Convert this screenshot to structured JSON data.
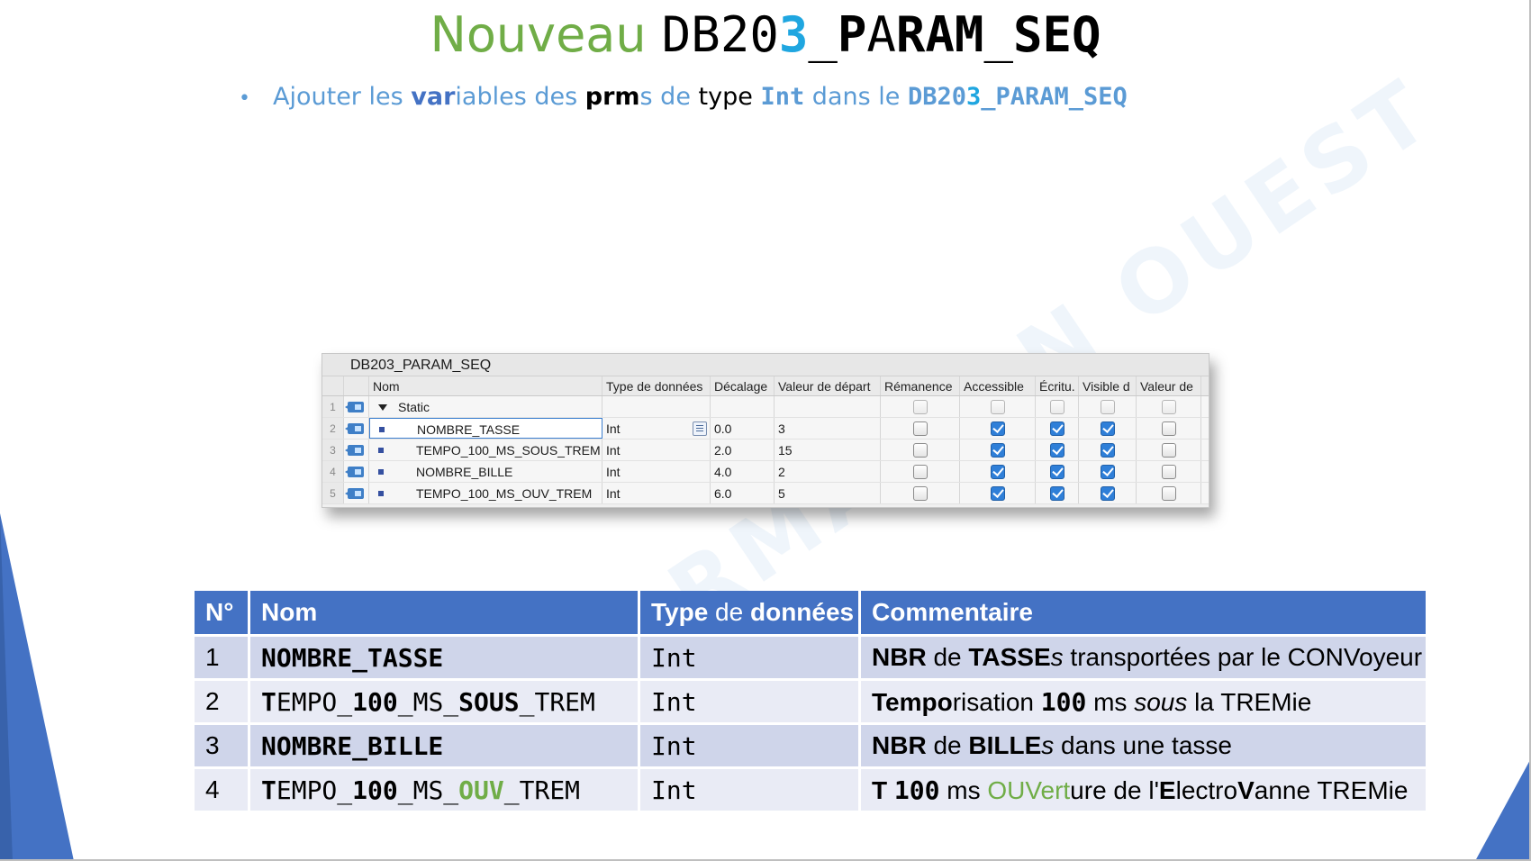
{
  "title": {
    "word": "Nouveau",
    "db_prefix": "DB20",
    "db_digit": "3",
    "db_sep": "_",
    "db_p": "P",
    "db_a": "A",
    "db_ram": "RAM",
    "db_seq_sep": "_",
    "db_seq": "SEQ"
  },
  "bullet": {
    "p1": "Ajouter les ",
    "var": "var",
    "p2": "iables des ",
    "prm": "prm",
    "p3": "s de ",
    "type_word": "type",
    "int": "Int",
    "p4": " dans le ",
    "db_a": "DB20",
    "db_b": "3",
    "db_c": "_PARAM_SEQ"
  },
  "watermark": "FORMATION OUEST",
  "tia": {
    "db_name": "DB203_PARAM_SEQ",
    "headers": {
      "nom": "Nom",
      "type": "Type de données",
      "decalage": "Décalage",
      "valeur": "Valeur de départ",
      "remanence": "Rémanence",
      "accessible": "Accessible",
      "ecriture": "Écritu.",
      "visible": "Visible d",
      "valeur_de": "Valeur de"
    },
    "rows": [
      {
        "idx": "1",
        "name": "Static",
        "type": "",
        "offset": "",
        "start": "",
        "remanence": false,
        "accessible": false,
        "ecriture": false,
        "visible": false,
        "valeur_de": false
      },
      {
        "idx": "2",
        "name": "NOMBRE_TASSE",
        "type": "Int",
        "offset": "0.0",
        "start": "3",
        "remanence": false,
        "accessible": true,
        "ecriture": true,
        "visible": true,
        "valeur_de": false
      },
      {
        "idx": "3",
        "name": "TEMPO_100_MS_SOUS_TREM",
        "type": "Int",
        "offset": "2.0",
        "start": "15",
        "remanence": false,
        "accessible": true,
        "ecriture": true,
        "visible": true,
        "valeur_de": false
      },
      {
        "idx": "4",
        "name": "NOMBRE_BILLE",
        "type": "Int",
        "offset": "4.0",
        "start": "2",
        "remanence": false,
        "accessible": true,
        "ecriture": true,
        "visible": true,
        "valeur_de": false
      },
      {
        "idx": "5",
        "name": "TEMPO_100_MS_OUV_TREM",
        "type": "Int",
        "offset": "6.0",
        "start": "5",
        "remanence": false,
        "accessible": true,
        "ecriture": true,
        "visible": true,
        "valeur_de": false
      }
    ]
  },
  "table": {
    "headers": {
      "n": "N°",
      "nom": "Nom",
      "type_a": "Type",
      "type_b": " de ",
      "type_c": "données",
      "comment": "Commentaire"
    },
    "rows": [
      {
        "n": "1",
        "nom_b": "NOMBRE_TASSE",
        "type": "Int",
        "c1": "NBR",
        "c2": " de ",
        "c3": "TASSE",
        "c4": "s",
        "c5": " transportées par le CONVoyeur"
      },
      {
        "n": "2",
        "nom_1": "T",
        "nom_2": "EMPO_",
        "nom_3": "100",
        "nom_4": "_MS_",
        "nom_5": "SOUS",
        "nom_6": "_TREM",
        "type": "Int",
        "c1": "Tempo",
        "c2": "risation ",
        "c3": "100",
        "c4": " ms ",
        "c5": "sous",
        "c6": " la TREMie"
      },
      {
        "n": "3",
        "nom_b": "NOMBRE_BILLE",
        "type": "Int",
        "c1": "NBR",
        "c2": " de ",
        "c3": "BILLE",
        "c4": "s",
        "c5": " dans une tasse"
      },
      {
        "n": "4",
        "nom_1": "T",
        "nom_2": "EMPO_",
        "nom_3": "100",
        "nom_4": "_MS_",
        "nom_5": "OUV",
        "nom_6": "_TREM",
        "type": "Int",
        "c1": "T ",
        "c2": "100",
        "c3": " ms ",
        "c4": "OUVert",
        "c5": "ure  de l'",
        "c6": "E",
        "c7": "lectro",
        "c8": "V",
        "c9": "anne TREMie"
      }
    ]
  },
  "colors": {
    "accent_blue": "#4472c4",
    "title_green": "#70ad47",
    "digit_cyan": "#1fa6e0",
    "bullet_blue": "#5b9bd5"
  }
}
